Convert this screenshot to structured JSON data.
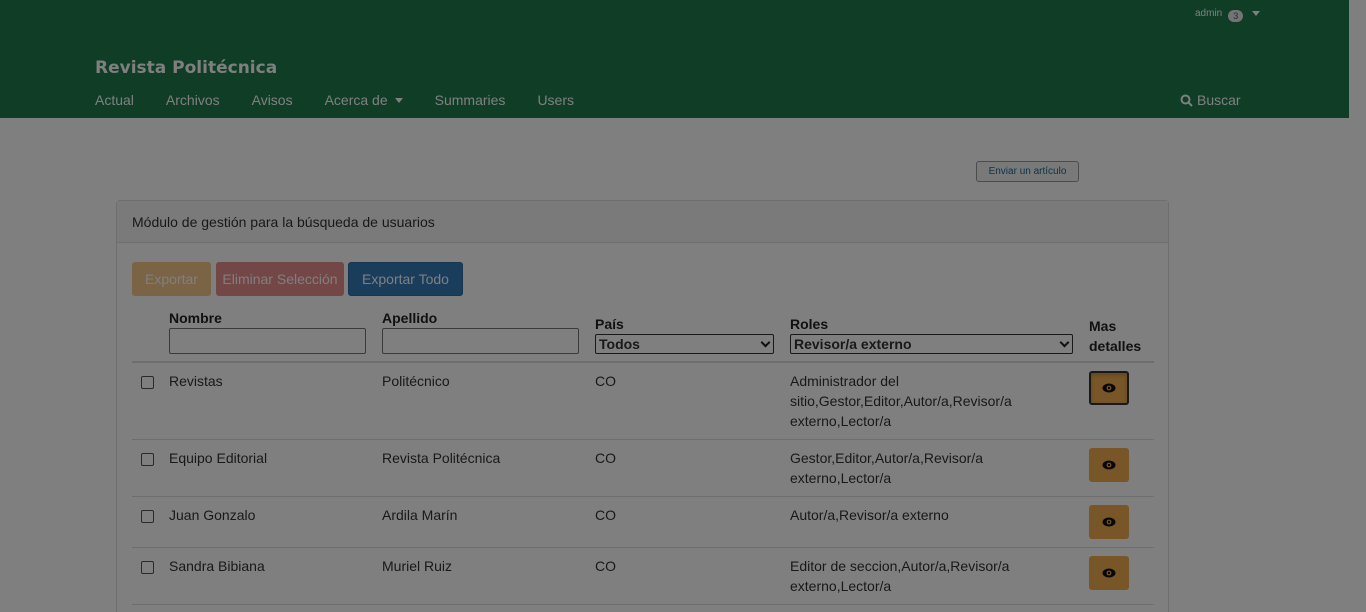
{
  "header": {
    "user": "admin",
    "notification_count": "3",
    "site_title": "Revista Politécnica",
    "nav": [
      "Actual",
      "Archivos",
      "Avisos",
      "Acerca de",
      "Summaries",
      "Users"
    ],
    "search_label": "Buscar"
  },
  "submit_button": "Enviar un artículo",
  "panel": {
    "title": "Módulo de gestión para la búsqueda de usuarios",
    "buttons": {
      "export": "Exportar",
      "delete_selection": "Eliminar Selección",
      "export_all": "Exportar Todo"
    },
    "columns": {
      "first_name": "Nombre",
      "last_name": "Apellido",
      "country": "País",
      "roles": "Roles",
      "details_line1": "Mas",
      "details_line2": "detalles"
    },
    "filters": {
      "country": "Todos",
      "roles": "Revisor/a externo"
    },
    "rows": [
      {
        "first_name": "Revistas",
        "last_name": "Politécnico",
        "country": "CO",
        "roles": "Administrador del sitio,Gestor,Editor,Autor/a,Revisor/a externo,Lector/a"
      },
      {
        "first_name": "Equipo Editorial",
        "last_name": "Revista Politécnica",
        "country": "CO",
        "roles": "Gestor,Editor,Autor/a,Revisor/a externo,Lector/a"
      },
      {
        "first_name": "Juan Gonzalo",
        "last_name": "Ardila Marín",
        "country": "CO",
        "roles": "Autor/a,Revisor/a externo"
      },
      {
        "first_name": "Sandra Bibiana",
        "last_name": "Muriel Ruiz",
        "country": "CO",
        "roles": "Editor de seccion,Autor/a,Revisor/a externo,Lector/a"
      }
    ]
  },
  "colors": {
    "header_bg": "#1f7a4a",
    "warning": "#f0ad4e",
    "danger": "#d9534f",
    "primary": "#337ab7"
  }
}
